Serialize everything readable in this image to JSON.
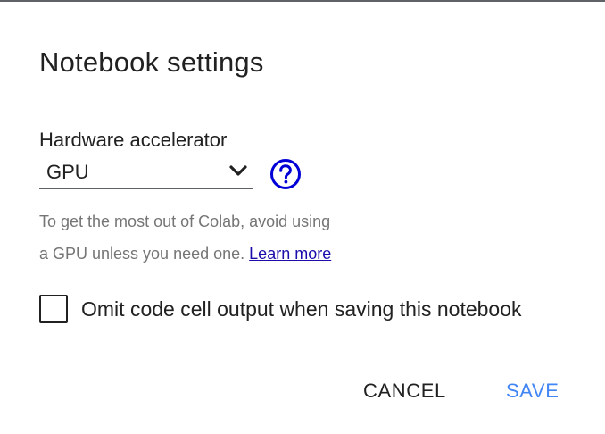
{
  "dialog": {
    "title": "Notebook settings",
    "hardware": {
      "label": "Hardware accelerator",
      "selected": "GPU"
    },
    "note": {
      "text_line1": "To get the most out of Colab, avoid using",
      "text_line2": "a GPU unless you need one.",
      "link": "Learn more"
    },
    "omit_output": {
      "label": "Omit code cell output when saving this notebook",
      "checked": false
    },
    "buttons": {
      "cancel": "CANCEL",
      "save": "SAVE"
    }
  },
  "icons": {
    "chevron": "chevron-down-icon",
    "help": "help-circle-icon"
  },
  "colors": {
    "help_icon": "#0000d6",
    "link": "#1a0dab",
    "save_button": "#4285f4",
    "text_primary": "#212121",
    "text_secondary": "#757575"
  }
}
